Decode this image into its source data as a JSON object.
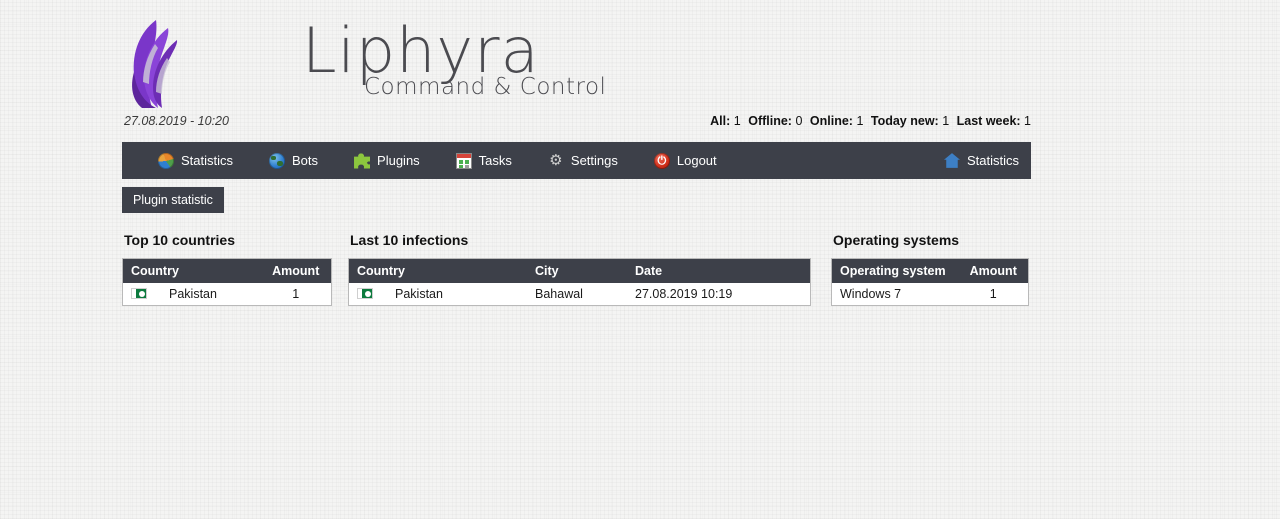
{
  "brand": {
    "name": "Liphyra",
    "tagline": "Command & Control",
    "wing_icon": "wing-icon",
    "wing_color": "#7a36c9"
  },
  "info": {
    "datetime": "27.08.2019 - 10:20",
    "counters": [
      {
        "label": "All:",
        "value": "1"
      },
      {
        "label": "Offline:",
        "value": "0"
      },
      {
        "label": "Online:",
        "value": "1"
      },
      {
        "label": "Today new:",
        "value": "1"
      },
      {
        "label": "Last week:",
        "value": "1"
      }
    ]
  },
  "nav": {
    "background": "#3d4049",
    "items": [
      {
        "label": "Statistics",
        "icon": "pie-chart-icon"
      },
      {
        "label": "Bots",
        "icon": "globe-icon"
      },
      {
        "label": "Plugins",
        "icon": "puzzle-piece-icon"
      },
      {
        "label": "Tasks",
        "icon": "calendar-icon"
      },
      {
        "label": "Settings",
        "icon": "gear-icon"
      },
      {
        "label": "Logout",
        "icon": "power-icon"
      }
    ],
    "right_item": {
      "label": "Statistics",
      "icon": "home-icon"
    }
  },
  "subtab": {
    "label": "Plugin statistic"
  },
  "panels": {
    "countries": {
      "title": "Top 10 countries",
      "columns": [
        "Country",
        "Amount"
      ],
      "rows": [
        {
          "flag": "flag-pakistan-icon",
          "country": "Pakistan",
          "amount": "1"
        }
      ]
    },
    "infections": {
      "title": "Last 10 infections",
      "columns": [
        "Country",
        "City",
        "Date"
      ],
      "rows": [
        {
          "flag": "flag-pakistan-icon",
          "country": "Pakistan",
          "city": "Bahawal",
          "date": "27.08.2019 10:19"
        }
      ]
    },
    "os": {
      "title": "Operating systems",
      "columns": [
        "Operating system",
        "Amount"
      ],
      "rows": [
        {
          "os": "Windows 7",
          "amount": "1"
        }
      ]
    }
  }
}
